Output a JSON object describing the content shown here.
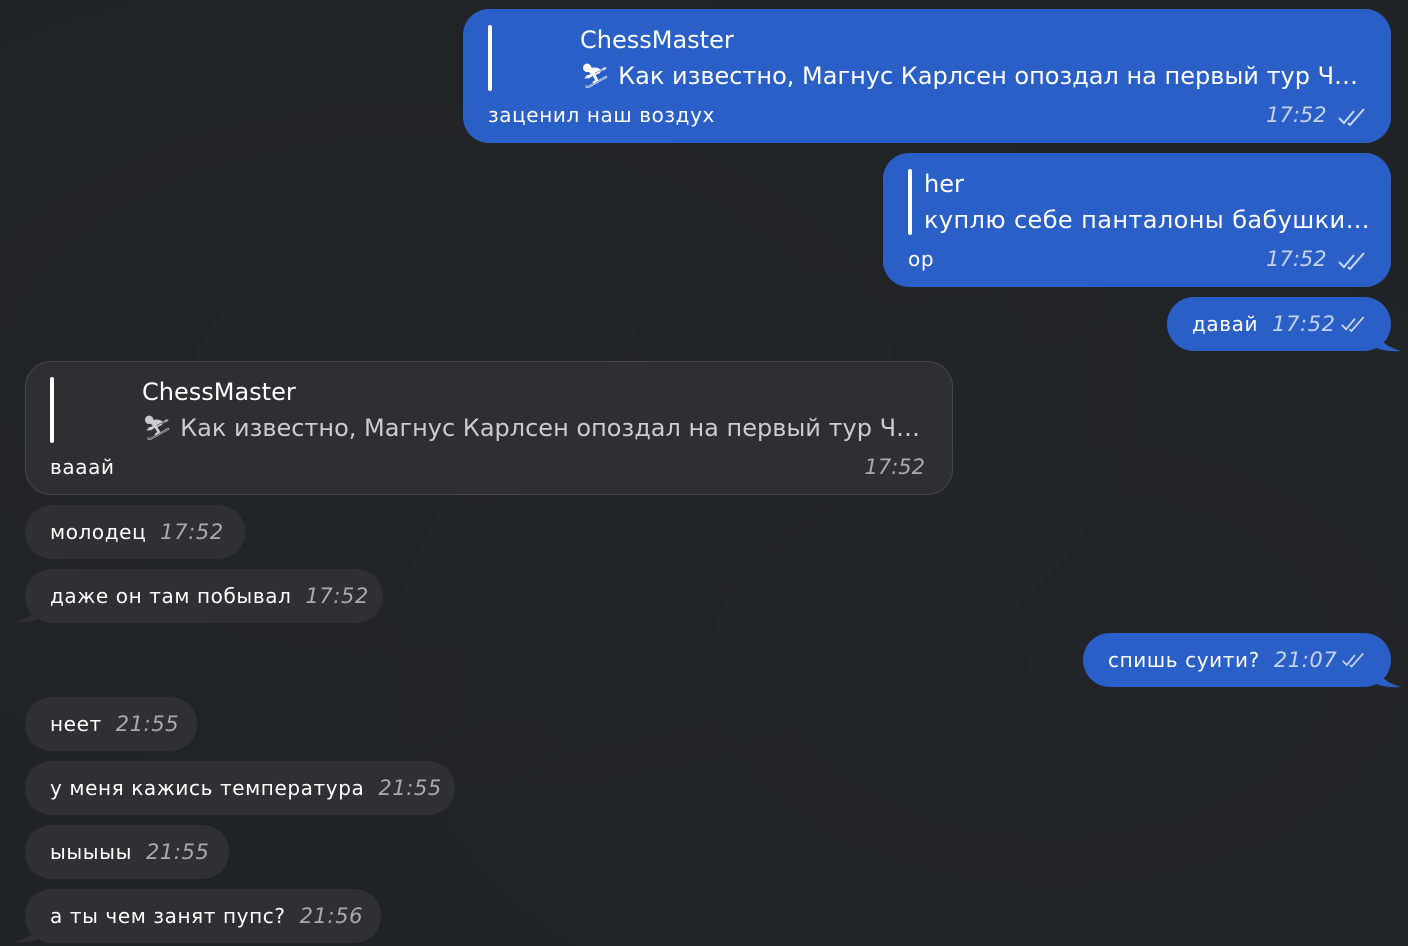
{
  "colors": {
    "background": "#202326",
    "outgoing": "#2b5fc8",
    "incoming": "#2e3033"
  },
  "messages": {
    "m1": {
      "reply_author": "ChessMaster",
      "reply_text": "⛷ Как известно, Магнус Карлсен опоздал на первый тур ЧМ...",
      "text": "заценил наш воздух",
      "time": "17:52"
    },
    "m2": {
      "reply_author": "her",
      "reply_text": "куплю себе панталоны бабушкины",
      "text": "ор",
      "time": "17:52"
    },
    "m3": {
      "text": "давай",
      "time": "17:52"
    },
    "m4": {
      "reply_author": "ChessMaster",
      "reply_text": "⛷ Как известно, Магнус Карлсен опоздал на первый тур ЧМ...",
      "text": "вааай",
      "time": "17:52"
    },
    "m5": {
      "text": "молодец",
      "time": "17:52"
    },
    "m6": {
      "text": "даже он там побывал",
      "time": "17:52"
    },
    "m7": {
      "text": "спишь суити?",
      "time": "21:07"
    },
    "m8": {
      "text": "неет",
      "time": "21:55"
    },
    "m9": {
      "text": "у меня кажись температура",
      "time": "21:55"
    },
    "m10": {
      "text": "ыыыыы",
      "time": "21:55"
    },
    "m11": {
      "text": "а ты чем занят пупс?",
      "time": "21:56"
    }
  },
  "icons": {
    "read_status": "double-check-icon"
  }
}
